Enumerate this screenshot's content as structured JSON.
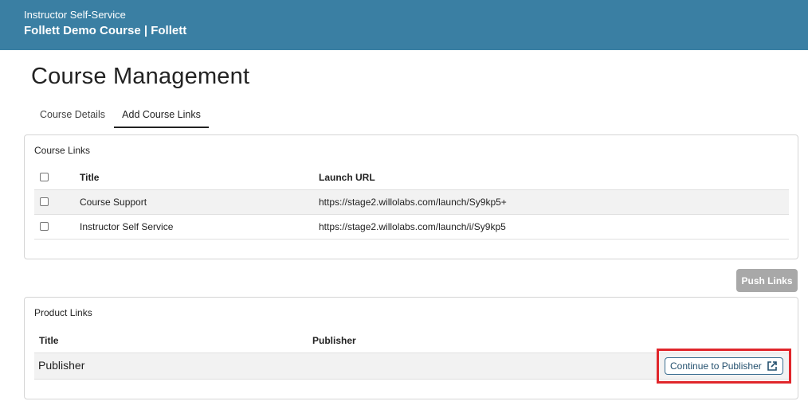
{
  "header": {
    "subtitle": "Instructor Self-Service",
    "title": "Follett Demo Course | Follett"
  },
  "page_title": "Course Management",
  "tabs": [
    {
      "label": "Course Details",
      "active": false
    },
    {
      "label": "Add Course Links",
      "active": true
    }
  ],
  "course_links": {
    "title": "Course Links",
    "columns": {
      "title": "Title",
      "url": "Launch URL"
    },
    "rows": [
      {
        "title": "Course Support",
        "url": "https://stage2.willolabs.com/launch/Sy9kp5+"
      },
      {
        "title": "Instructor Self Service",
        "url": "https://stage2.willolabs.com/launch/i/Sy9kp5"
      }
    ]
  },
  "push_links_label": "Push Links",
  "product_links": {
    "title": "Product Links",
    "columns": {
      "title": "Title",
      "publisher": "Publisher"
    },
    "rows": [
      {
        "title": "Publisher",
        "publisher": "",
        "action_label": "Continue to Publisher",
        "action_icon": "external-link-icon"
      }
    ]
  },
  "colors": {
    "header_bg": "#3a7fa3",
    "highlight": "#e0262b",
    "push_button_bg": "#a8a8a8",
    "row_shade": "#f2f2f2"
  }
}
